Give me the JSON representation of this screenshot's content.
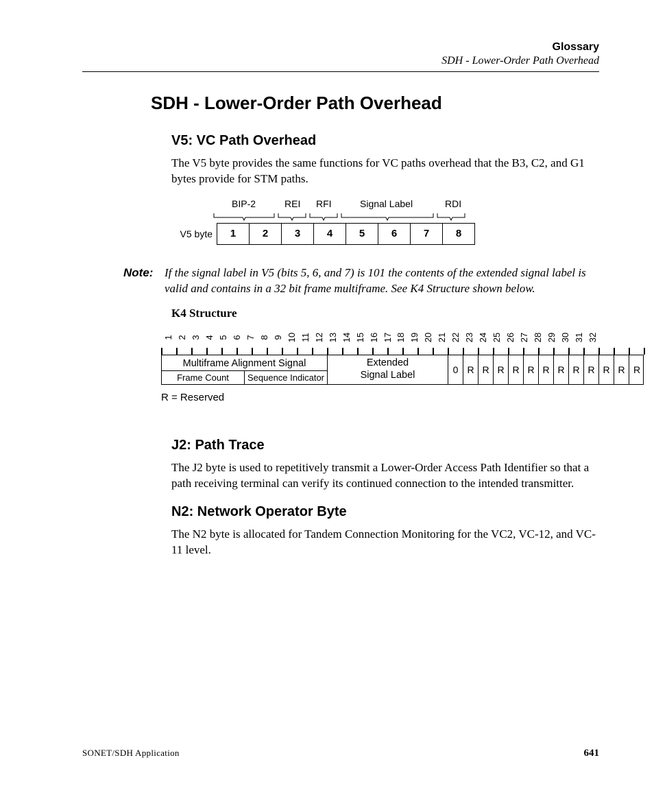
{
  "header": {
    "title": "Glossary",
    "subtitle": "SDH - Lower-Order Path Overhead"
  },
  "h1": "SDH - Lower-Order Path Overhead",
  "v5": {
    "heading": "V5: VC Path Overhead",
    "text": "The V5 byte provides the same functions for VC paths overhead that the B3, C2, and G1 bytes provide for STM paths.",
    "diagram": {
      "row_label": "V5 byte",
      "labels": [
        "BIP-2",
        "REI",
        "RFI",
        "Signal Label",
        "RDI"
      ],
      "bits": [
        "1",
        "2",
        "3",
        "4",
        "5",
        "6",
        "7",
        "8"
      ]
    }
  },
  "note": {
    "label": "Note:",
    "text": "If the signal label in V5 (bits 5, 6, and 7) is 101 the contents of the extended signal label is valid and contains in a 32 bit frame multiframe. See K4 Structure shown below."
  },
  "k4": {
    "title": "K4 Structure",
    "nums": [
      "1",
      "2",
      "3",
      "4",
      "5",
      "6",
      "7",
      "8",
      "9",
      "10",
      "11",
      "12",
      "13",
      "14",
      "15",
      "16",
      "17",
      "18",
      "19",
      "20",
      "21",
      "22",
      "23",
      "24",
      "25",
      "26",
      "27",
      "28",
      "29",
      "30",
      "31",
      "32"
    ],
    "mas": "Multiframe Alignment Signal",
    "fc": "Frame Count",
    "si": "Sequence Indicator",
    "esl": "Extended\nSignal Label",
    "cells": [
      "0",
      "R",
      "R",
      "R",
      "R",
      "R",
      "R",
      "R",
      "R",
      "R",
      "R",
      "R",
      "R"
    ],
    "legend": "R = Reserved"
  },
  "j2": {
    "heading": "J2: Path Trace",
    "text": "The J2 byte is used to repetitively transmit a Lower-Order Access Path Identifier so that a path receiving terminal can verify its continued connection to the intended transmitter."
  },
  "n2": {
    "heading": "N2: Network Operator Byte",
    "text": "The N2 byte is allocated for Tandem Connection Monitoring for the VC2, VC-12, and VC-11 level."
  },
  "footer": {
    "left": "SONET/SDH Application",
    "page": "641"
  }
}
